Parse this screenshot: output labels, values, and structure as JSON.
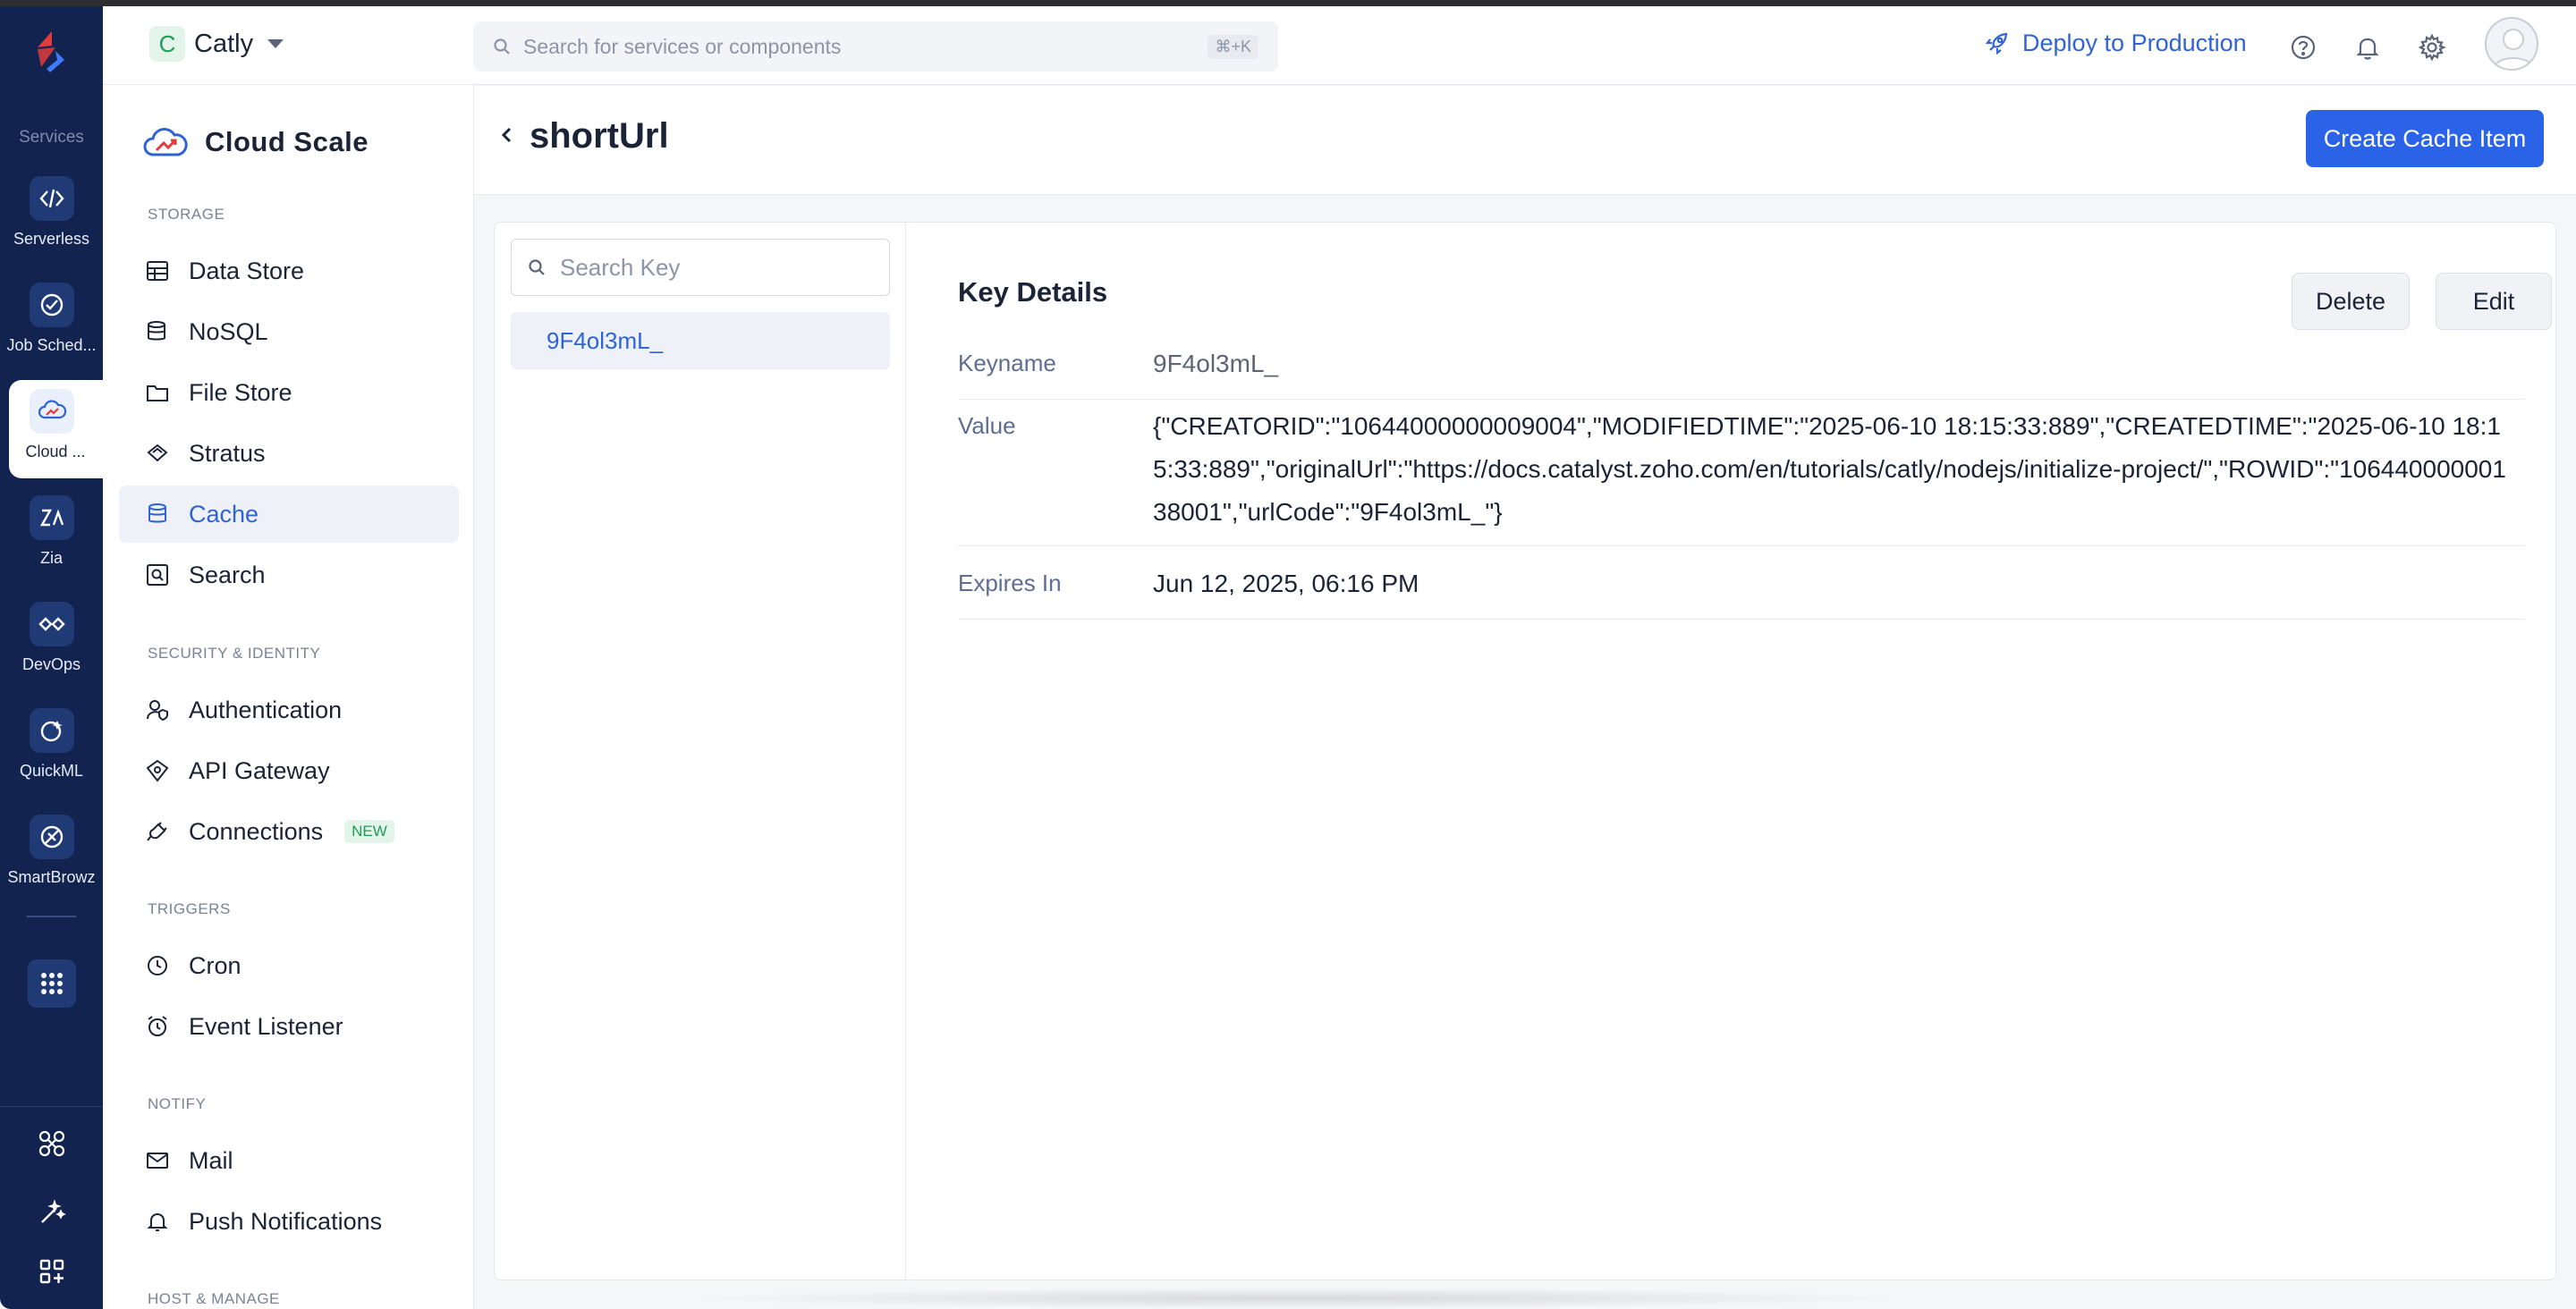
{
  "rail": {
    "services_label": "Services",
    "items": [
      {
        "label": "Serverless",
        "icon": "serverless-icon"
      },
      {
        "label": "Job Sched...",
        "icon": "job-scheduling-icon"
      },
      {
        "label": "Cloud ...",
        "icon": "cloud-scale-icon"
      },
      {
        "label": "Zia",
        "icon": "zia-icon"
      },
      {
        "label": "DevOps",
        "icon": "devops-icon"
      },
      {
        "label": "QuickML",
        "icon": "quickml-icon"
      },
      {
        "label": "SmartBrowz",
        "icon": "smartbrowz-icon"
      }
    ]
  },
  "header": {
    "project_initial": "C",
    "project_name": "Catly",
    "search_placeholder": "Search for services or components",
    "search_shortcut": "⌘+K",
    "deploy_label": "Deploy to Production"
  },
  "sidebar": {
    "title": "Cloud Scale",
    "sections": {
      "storage": "STORAGE",
      "security": "SECURITY & IDENTITY",
      "triggers": "TRIGGERS",
      "notify": "NOTIFY",
      "host": "HOST & MANAGE"
    },
    "items": {
      "data_store": "Data Store",
      "nosql": "NoSQL",
      "file_store": "File Store",
      "stratus": "Stratus",
      "cache": "Cache",
      "search": "Search",
      "authentication": "Authentication",
      "api_gateway": "API Gateway",
      "connections": "Connections",
      "connections_badge": "NEW",
      "cron": "Cron",
      "event_listener": "Event Listener",
      "mail": "Mail",
      "push_notifications": "Push Notifications"
    }
  },
  "main": {
    "title": "shortUrl",
    "create_button": "Create Cache Item",
    "key_search_placeholder": "Search Key",
    "keys": [
      "9F4ol3mL_"
    ],
    "details": {
      "title": "Key Details",
      "delete_label": "Delete",
      "edit_label": "Edit",
      "keyname_label": "Keyname",
      "keyname_value": "9F4ol3mL_",
      "value_label": "Value",
      "value_value": "{\"CREATORID\":\"10644000000009004\",\"MODIFIEDTIME\":\"2025-06-10 18:15:33:889\",\"CREATEDTIME\":\"2025-06-10 18:15:33:889\",\"originalUrl\":\"https://docs.catalyst.zoho.com/en/tutorials/catly/nodejs/initialize-project/\",\"ROWID\":\"10644000000138001\",\"urlCode\":\"9F4ol3mL_\"}",
      "expires_label": "Expires In",
      "expires_value": "Jun 12, 2025, 06:16 PM"
    }
  },
  "colors": {
    "rail_bg": "#13234f",
    "accent": "#2b63e8",
    "link": "#2f63d6",
    "new_badge": "#1f9d55"
  }
}
